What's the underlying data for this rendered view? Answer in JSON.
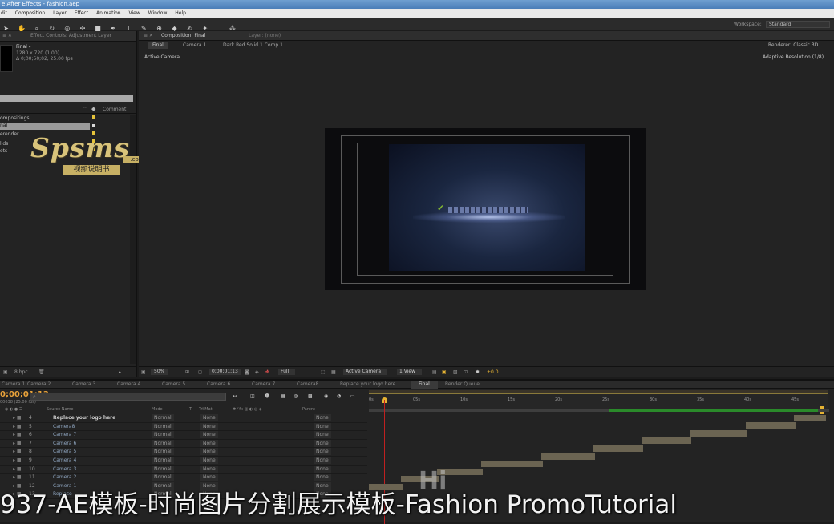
{
  "window": {
    "title": "e After Effects - fashion.aep"
  },
  "menu": [
    "dit",
    "Composition",
    "Layer",
    "Effect",
    "Animation",
    "View",
    "Window",
    "Help"
  ],
  "workspace": {
    "label": "Workspace:",
    "value": "Standard"
  },
  "left_panel": {
    "tab_effect_controls": "Effect Controls: Adjustment Layer",
    "comp_name": "Final ▾",
    "comp_info_1": "1280 x 720 (1.00)",
    "comp_info_2": "Δ 0;00;50;02, 25.00 fps",
    "col_comment": "Comment",
    "items": [
      "ompositings",
      "nal",
      "erender",
      "lids",
      "ots"
    ],
    "bpc": "8 bpc"
  },
  "viewer": {
    "tab_comp": "Composition: Final",
    "tab_layer": "Layer: (none)",
    "breadcrumbs": [
      "Final",
      "Camera 1",
      "Dark Red Solid 1 Comp 1"
    ],
    "renderer": "Renderer:  Classic 3D",
    "active_camera": "Active Camera",
    "adaptive_resolution": "Adaptive Resolution (1/8)",
    "zoom": "50%",
    "timecode": "0;00;01;13",
    "quality": "Full",
    "view_camera": "Active Camera",
    "views": "1 View",
    "exposure": "+0.0"
  },
  "timeline": {
    "tabs": [
      "Camera 1",
      "Camera 2",
      "Camera 3",
      "Camera 4",
      "Camera 5",
      "Camera 6",
      "Camera 7",
      "Camera8",
      "Replace your logo here",
      "Final",
      "Render Queue"
    ],
    "timecode": "0;00;01;13",
    "fps": "00038 (25.00 fps)",
    "headers": {
      "source": "Source Name",
      "mode": "Mode",
      "t": "T",
      "trkmat": "TrkMat",
      "parent": "Parent"
    },
    "ruler": [
      "0s",
      "05s",
      "10s",
      "15s",
      "20s",
      "25s",
      "30s",
      "35s",
      "40s",
      "45s"
    ],
    "layers": [
      {
        "num": "4",
        "name": "Replace your logo here",
        "mode": "Normal",
        "trk": "None",
        "parent": "None"
      },
      {
        "num": "5",
        "name": "Camera8",
        "mode": "Normal",
        "trk": "None",
        "parent": "None"
      },
      {
        "num": "6",
        "name": "Camera 7",
        "mode": "Normal",
        "trk": "None",
        "parent": "None"
      },
      {
        "num": "7",
        "name": "Camera 6",
        "mode": "Normal",
        "trk": "None",
        "parent": "None"
      },
      {
        "num": "8",
        "name": "Camera 5",
        "mode": "Normal",
        "trk": "None",
        "parent": "None"
      },
      {
        "num": "9",
        "name": "Camera 4",
        "mode": "Normal",
        "trk": "None",
        "parent": "None"
      },
      {
        "num": "10",
        "name": "Camera 3",
        "mode": "Normal",
        "trk": "None",
        "parent": "None"
      },
      {
        "num": "11",
        "name": "Camera 2",
        "mode": "Normal",
        "trk": "None",
        "parent": "None"
      },
      {
        "num": "12",
        "name": "Camera 1",
        "mode": "Normal",
        "trk": "None",
        "parent": "None"
      },
      {
        "num": "13",
        "name": "Replace",
        "mode": "Normal",
        "trk": "None",
        "parent": "None"
      }
    ]
  },
  "watermark": {
    "brand": "Spsms",
    "tld": ".com",
    "subtitle": "视频说明书"
  },
  "overlay_text": "Hi",
  "caption": "937-AE模板-时尚图片分割展示模板-Fashion PromoTutorial",
  "colors": {
    "accent_yellow": "#e6b333",
    "timecode_orange": "#e8a23a",
    "logo_green": "#7fb332"
  }
}
